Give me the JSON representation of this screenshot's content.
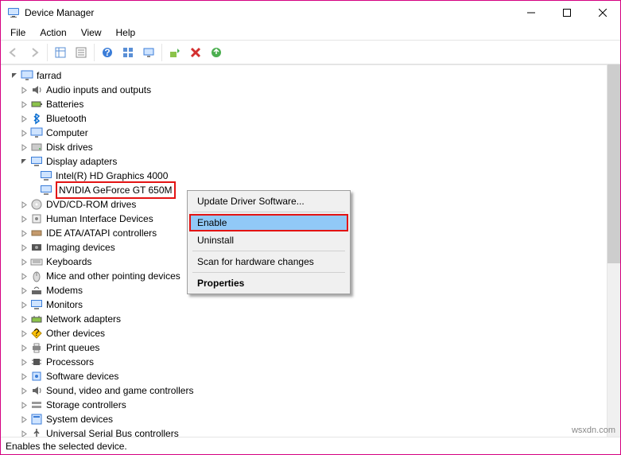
{
  "window": {
    "title": "Device Manager"
  },
  "menu": {
    "file": "File",
    "action": "Action",
    "view": "View",
    "help": "Help"
  },
  "tree": {
    "root": "farrad",
    "nodes": [
      {
        "label": "Audio inputs and outputs",
        "exp": false
      },
      {
        "label": "Batteries",
        "exp": false
      },
      {
        "label": "Bluetooth",
        "exp": false
      },
      {
        "label": "Computer",
        "exp": false
      },
      {
        "label": "Disk drives",
        "exp": false
      },
      {
        "label": "Display adapters",
        "exp": true,
        "children": [
          {
            "label": "Intel(R) HD Graphics 4000"
          },
          {
            "label": "NVIDIA GeForce GT 650M",
            "selected": true,
            "disabled": true
          }
        ]
      },
      {
        "label": "DVD/CD-ROM drives",
        "exp": false
      },
      {
        "label": "Human Interface Devices",
        "exp": false
      },
      {
        "label": "IDE ATA/ATAPI controllers",
        "exp": false
      },
      {
        "label": "Imaging devices",
        "exp": false
      },
      {
        "label": "Keyboards",
        "exp": false
      },
      {
        "label": "Mice and other pointing devices",
        "exp": false
      },
      {
        "label": "Modems",
        "exp": false
      },
      {
        "label": "Monitors",
        "exp": false
      },
      {
        "label": "Network adapters",
        "exp": false
      },
      {
        "label": "Other devices",
        "exp": false
      },
      {
        "label": "Print queues",
        "exp": false
      },
      {
        "label": "Processors",
        "exp": false
      },
      {
        "label": "Software devices",
        "exp": false
      },
      {
        "label": "Sound, video and game controllers",
        "exp": false
      },
      {
        "label": "Storage controllers",
        "exp": false
      },
      {
        "label": "System devices",
        "exp": false
      },
      {
        "label": "Universal Serial Bus controllers",
        "exp": false
      }
    ]
  },
  "context_menu": {
    "update": "Update Driver Software...",
    "enable": "Enable",
    "uninstall": "Uninstall",
    "scan": "Scan for hardware changes",
    "properties": "Properties"
  },
  "status": "Enables the selected device.",
  "watermark": "wsxdn.com"
}
